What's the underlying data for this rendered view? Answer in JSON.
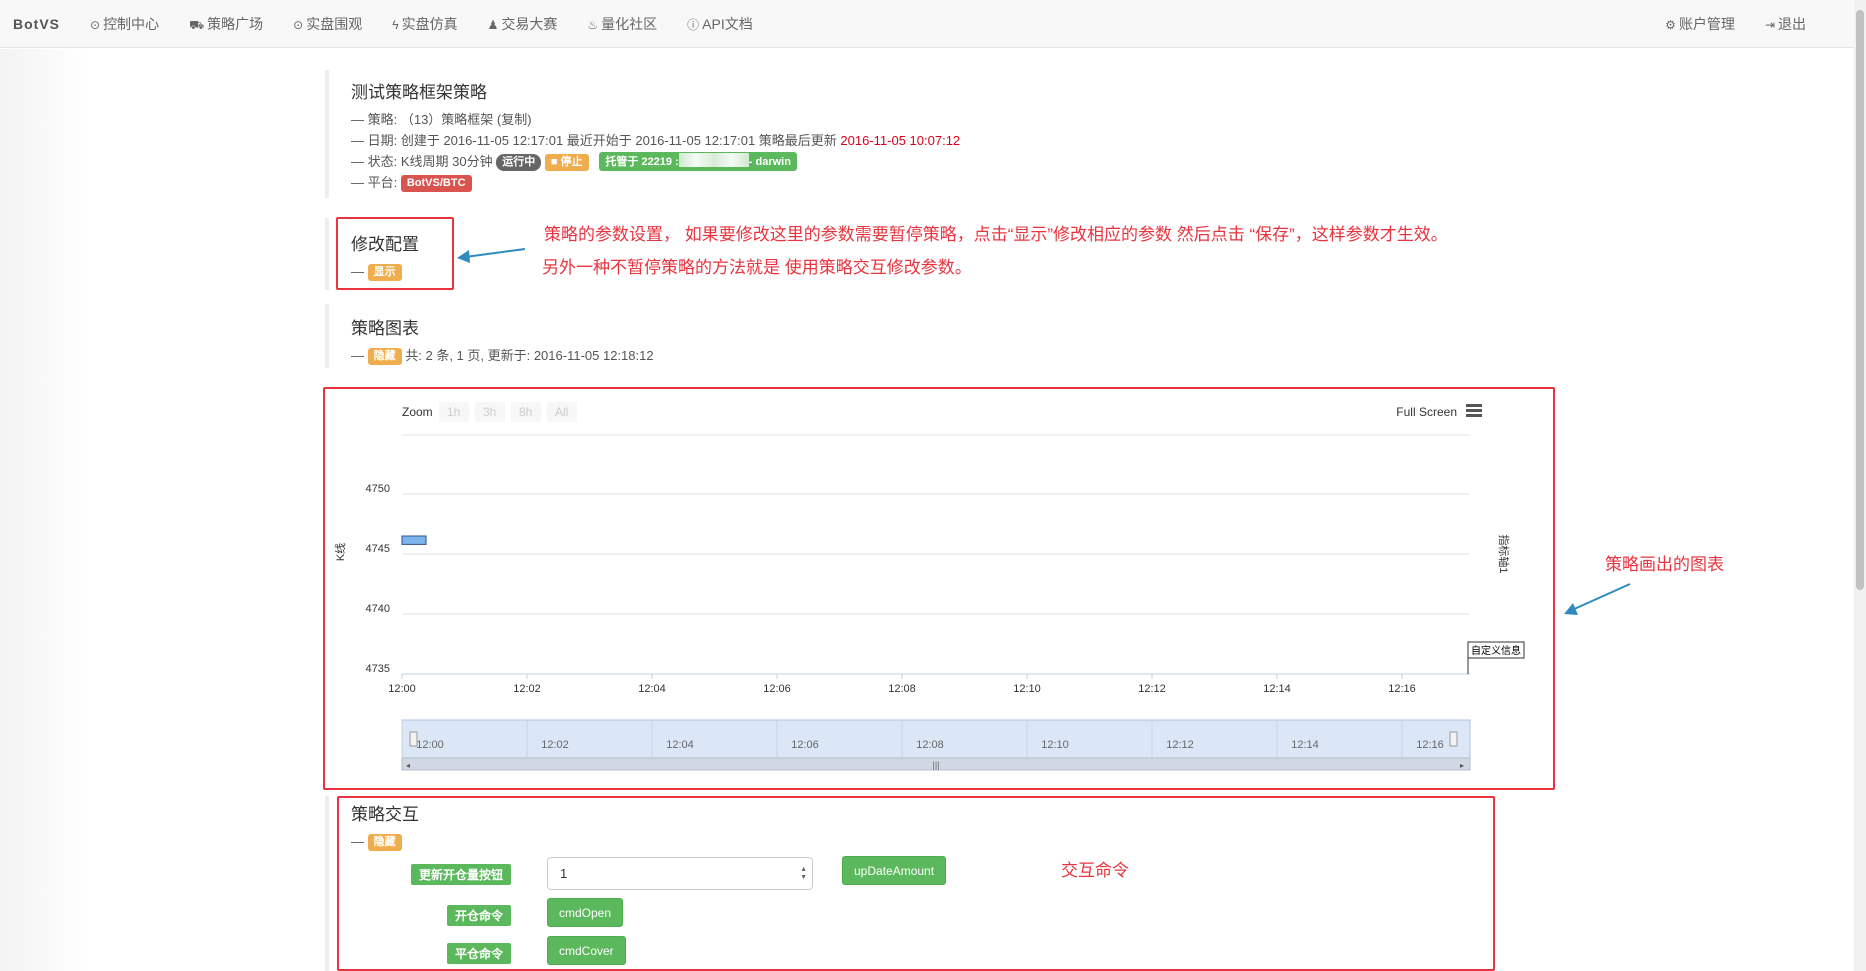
{
  "nav": {
    "brand": "BotVS",
    "items": [
      {
        "label": "控制中心",
        "icon": "dashboard-icon",
        "glyph": "⊙"
      },
      {
        "label": "策略广场",
        "icon": "cart-icon",
        "glyph": "⛟"
      },
      {
        "label": "实盘围观",
        "icon": "play-icon",
        "glyph": "⊙"
      },
      {
        "label": "实盘仿真",
        "icon": "bolt-icon",
        "glyph": "ϟ"
      },
      {
        "label": "交易大赛",
        "icon": "trophy-icon",
        "glyph": "♟"
      },
      {
        "label": "量化社区",
        "icon": "fire-icon",
        "glyph": "♨"
      },
      {
        "label": "API文档",
        "icon": "info-icon",
        "glyph": "ⓘ"
      }
    ],
    "right": [
      {
        "label": "账户管理",
        "icon": "gear-icon",
        "glyph": "⚙"
      },
      {
        "label": "退出",
        "icon": "logout-icon",
        "glyph": "⇥"
      }
    ]
  },
  "info": {
    "title": "测试策略框架策略",
    "strategy": "— 策略: （13）策略框架 (复制)",
    "date_prefix": "— 日期: 创建于 2016-11-05 12:17:01 最近开始于 2016-11-05 12:17:01 策略最后更新",
    "date_updated": "2016-11-05 10:07:12",
    "status_prefix": "— 状态: K线周期 30分钟",
    "badge_running": "运行中",
    "badge_stop": "停止",
    "host_prefix": "托管于 22219 :",
    "host_suffix": "- darwin",
    "platform_prefix": "— 平台:",
    "platform_badge": "BotVS/BTC"
  },
  "config": {
    "title": "修改配置",
    "dash": "—",
    "show_badge": "显示"
  },
  "chart_section": {
    "title": "策略图表",
    "dash": "—",
    "hide_badge": "隐藏",
    "meta": "共: 2 条, 1 页, 更新于: 2016-11-05 12:18:12"
  },
  "interaction": {
    "title": "策略交互",
    "dash": "—",
    "hide_badge": "隐藏",
    "rows": [
      {
        "label": "更新开仓量按钮",
        "input_value": "1",
        "button": "upDateAmount"
      },
      {
        "label": "开仓命令",
        "button": "cmdOpen"
      },
      {
        "label": "平仓命令",
        "button": "cmdCover"
      }
    ]
  },
  "annotations": {
    "config_note_1": "策略的参数设置， 如果要修改这里的参数需要暂停策略，点击“显示”修改相应的参数 然后点击 “保存”，这样参数才生效。",
    "config_note_2": "另外一种不暂停策略的方法就是 使用策略交互修改参数。",
    "chart_note": "策略画出的图表",
    "interaction_note": "交互命令"
  },
  "chart_data": {
    "type": "bar",
    "zoom_label": "Zoom",
    "zoom_buttons": [
      "1h",
      "3h",
      "8h",
      "All"
    ],
    "fullscreen_label": "Full Screen",
    "ylabel": "K线",
    "y2label": "指标轴1",
    "ylim": [
      4735,
      4750
    ],
    "yticks": [
      4735,
      4740,
      4745,
      4750
    ],
    "xticks": [
      "12:00",
      "12:02",
      "12:04",
      "12:06",
      "12:08",
      "12:10",
      "12:12",
      "12:14",
      "12:16"
    ],
    "navigator_ticks": [
      "12:00",
      "12:02",
      "12:04",
      "12:06",
      "12:08",
      "12:10",
      "12:12",
      "12:14",
      "12:16"
    ],
    "candles": [
      {
        "x": "12:00",
        "open": 4746.5,
        "close": 4745.8
      }
    ],
    "flag_label": "自定义信息"
  }
}
